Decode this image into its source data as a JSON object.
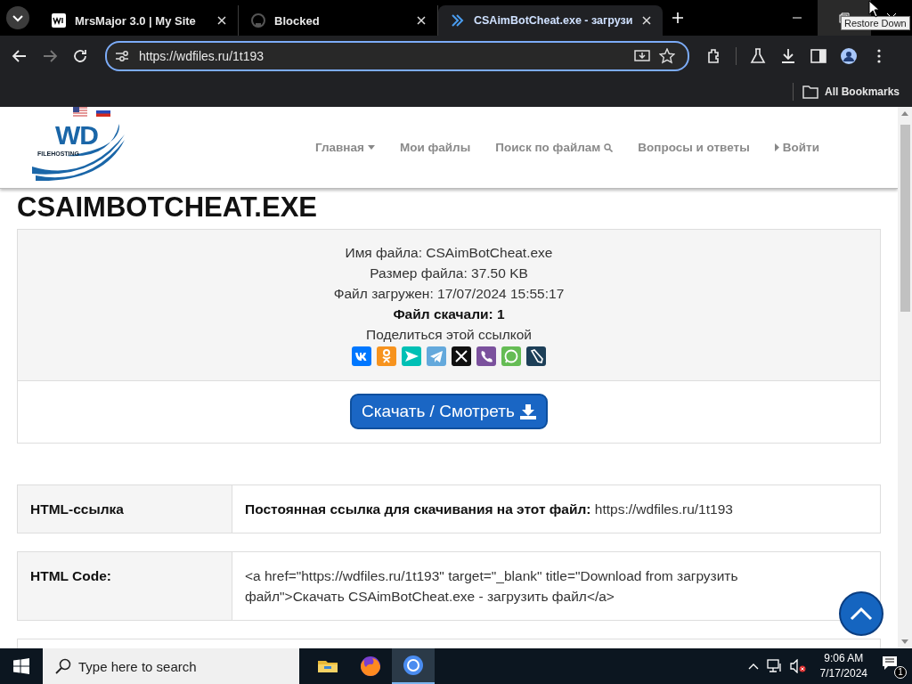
{
  "browser": {
    "tabs": [
      {
        "title": "MrsMajor 3.0 | My Site",
        "kind": "wix",
        "selected": false
      },
      {
        "title": "Blocked",
        "kind": "github",
        "selected": false
      },
      {
        "title": "CSAimBotCheat.exe - загрузи",
        "kind": "site",
        "selected": true
      }
    ],
    "address": "https://wdfiles.ru/1t193",
    "bookmarks_label": "All Bookmarks",
    "tooltip": "Restore Down"
  },
  "site": {
    "logo": {
      "mark": "WD",
      "subtitle": "FILEHOSTING"
    },
    "nav": [
      {
        "label": "Главная",
        "kind": "dropdown"
      },
      {
        "label": "Мои файлы",
        "kind": "plain"
      },
      {
        "label": "Поиск по файлам",
        "kind": "search"
      },
      {
        "label": "Вопросы и ответы",
        "kind": "plain"
      },
      {
        "label": "Войти",
        "kind": "login"
      }
    ]
  },
  "page": {
    "title": "CSAIMBOTCHEAT.EXE",
    "info": [
      {
        "text": "Имя файла: CSAimBotCheat.exe",
        "bold": false
      },
      {
        "text": "Размер файла: 37.50 KB",
        "bold": false
      },
      {
        "text": "Файл загружен: 17/07/2024 15:55:17",
        "bold": false
      },
      {
        "text": "Файл скачали: 1",
        "bold": true
      }
    ],
    "share_label": "Поделиться этой ссылкой",
    "share": [
      {
        "kind": "vk",
        "color": "#0077ff"
      },
      {
        "kind": "ok",
        "color": "#f7931e"
      },
      {
        "kind": "send",
        "color": "#00c0b5"
      },
      {
        "kind": "telegram",
        "color": "#64a9dc"
      },
      {
        "kind": "x",
        "color": "#111111"
      },
      {
        "kind": "viber",
        "color": "#7b519d"
      },
      {
        "kind": "whatsapp",
        "color": "#65bc54"
      },
      {
        "kind": "livejournal",
        "color": "#1d3f58"
      }
    ],
    "download_button": "Скачать / Смотреть",
    "links": [
      {
        "label": "HTML-ссылка",
        "value": "**Постоянная ссылка для скачивания на этот файл:** https://wdfiles.ru/1t193"
      },
      {
        "label": "HTML Code:",
        "value": "<a href=\"https://wdfiles.ru/1t193\" target=\"_blank\" title=\"Download from загрузить файл\">Скачать CSAimBotCheat.exe - загрузить файл</a>"
      }
    ]
  },
  "taskbar": {
    "search_placeholder": "Type here to search",
    "apps": [
      {
        "kind": "explorer",
        "selected": false
      },
      {
        "kind": "firefox",
        "selected": false
      },
      {
        "kind": "chrome",
        "selected": true
      }
    ],
    "time": "9:06 AM",
    "date": "7/17/2024",
    "notifications": "1"
  }
}
